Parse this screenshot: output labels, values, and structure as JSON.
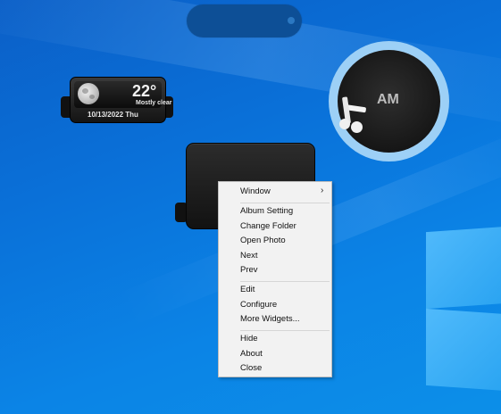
{
  "weather": {
    "temperature": "22°",
    "condition": "Mostly clear",
    "date": "10/13/2022 Thu"
  },
  "clock": {
    "period": "AM"
  },
  "context_menu": {
    "items": [
      {
        "label": "Window",
        "submenu_arrow": "›"
      },
      {
        "label": "Album Setting"
      },
      {
        "label": "Change Folder"
      },
      {
        "label": "Open Photo"
      },
      {
        "label": "Next"
      },
      {
        "label": "Prev"
      },
      {
        "label": "Edit"
      },
      {
        "label": "Configure"
      },
      {
        "label": "More Widgets..."
      },
      {
        "label": "Hide"
      },
      {
        "label": "About"
      },
      {
        "label": "Close"
      }
    ]
  },
  "colors": {
    "desktop": "#0a70d8",
    "menu_bg": "#f2f2f2",
    "clock_ring": "#9dd0f6"
  }
}
